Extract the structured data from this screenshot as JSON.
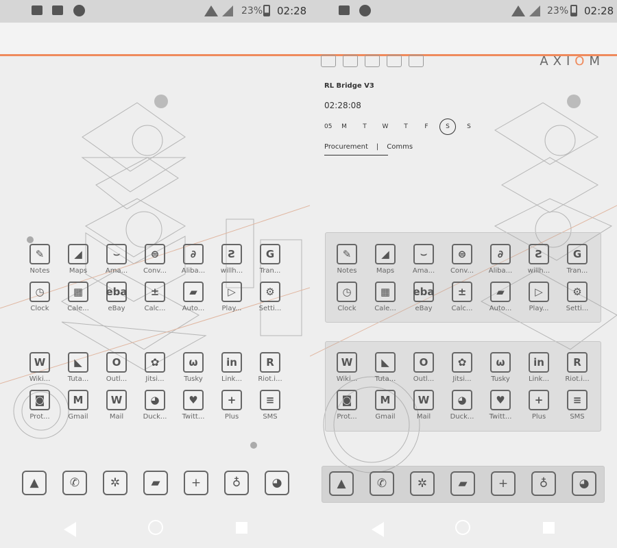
{
  "status_bar": {
    "battery": "23%",
    "time": "02:28"
  },
  "brand": {
    "name_left": "AXI",
    "name_o": "O",
    "name_right": "M"
  },
  "widget": {
    "title": "RL Bridge V3",
    "clock": "02:28:08",
    "date_num": "05",
    "days": [
      "M",
      "T",
      "W",
      "T",
      "F",
      "S",
      "S"
    ],
    "selected_day_index": 5,
    "links": [
      "Procurement",
      "Comms"
    ],
    "separator": "|"
  },
  "grid1": [
    {
      "label": "Notes",
      "icon": "notes-icon",
      "glyph": "✎"
    },
    {
      "label": "Maps",
      "icon": "maps-icon",
      "glyph": "◢"
    },
    {
      "label": "Ama...",
      "icon": "amazon-icon",
      "glyph": "⌣"
    },
    {
      "label": "Conv...",
      "icon": "converter-icon",
      "glyph": "⊜"
    },
    {
      "label": "Aliba...",
      "icon": "alibaba-icon",
      "glyph": "∂"
    },
    {
      "label": "willh...",
      "icon": "willhaben-icon",
      "glyph": "Ƨ"
    },
    {
      "label": "Tran...",
      "icon": "translate-icon",
      "glyph": "G"
    },
    {
      "label": "Clock",
      "icon": "clock-icon",
      "glyph": "◷"
    },
    {
      "label": "Cale...",
      "icon": "calendar-icon",
      "glyph": "▦"
    },
    {
      "label": "eBay",
      "icon": "ebay-icon",
      "glyph": "eba"
    },
    {
      "label": "Calc...",
      "icon": "calculator-icon",
      "glyph": "±"
    },
    {
      "label": "Auto...",
      "icon": "automate-icon",
      "glyph": "▰"
    },
    {
      "label": "Play...",
      "icon": "play-store-icon",
      "glyph": "▷"
    },
    {
      "label": "Setti...",
      "icon": "settings-icon",
      "glyph": "⚙"
    }
  ],
  "grid2": [
    {
      "label": "Wiki...",
      "icon": "wikipedia-icon",
      "glyph": "W"
    },
    {
      "label": "Tuta...",
      "icon": "tutanota-icon",
      "glyph": "◣"
    },
    {
      "label": "Outl...",
      "icon": "outlook-icon",
      "glyph": "O"
    },
    {
      "label": "Jitsi...",
      "icon": "jitsi-icon",
      "glyph": "✿"
    },
    {
      "label": "Tusky",
      "icon": "tusky-icon",
      "glyph": "ω"
    },
    {
      "label": "Link...",
      "icon": "linkedin-icon",
      "glyph": "in"
    },
    {
      "label": "Riot.i...",
      "icon": "riot-icon",
      "glyph": "R"
    },
    {
      "label": "Prot...",
      "icon": "protonmail-icon",
      "glyph": "◙"
    },
    {
      "label": "Gmail",
      "icon": "gmail-icon",
      "glyph": "M"
    },
    {
      "label": "Mail",
      "icon": "mail-icon",
      "glyph": "W"
    },
    {
      "label": "Duck...",
      "icon": "duckduckgo-icon",
      "glyph": "◕"
    },
    {
      "label": "Twitt...",
      "icon": "twitter-icon",
      "glyph": "♥"
    },
    {
      "label": "Plus",
      "icon": "plus-messenger-icon",
      "glyph": "+"
    },
    {
      "label": "SMS",
      "icon": "sms-icon",
      "glyph": "≡"
    }
  ],
  "dock": [
    {
      "icon": "gallery-icon",
      "glyph": "▲"
    },
    {
      "icon": "phone-icon",
      "glyph": "✆"
    },
    {
      "icon": "network-icon",
      "glyph": "✲"
    },
    {
      "icon": "files-icon",
      "glyph": "▰"
    },
    {
      "icon": "signal-icon",
      "glyph": "+"
    },
    {
      "icon": "microphone-icon",
      "glyph": "♁"
    },
    {
      "icon": "duckduckgo-icon",
      "glyph": "◕"
    }
  ],
  "colors": {
    "accent": "#ef8a5c",
    "status_bar": "#d6d6d6",
    "background": "#eeeeee"
  }
}
